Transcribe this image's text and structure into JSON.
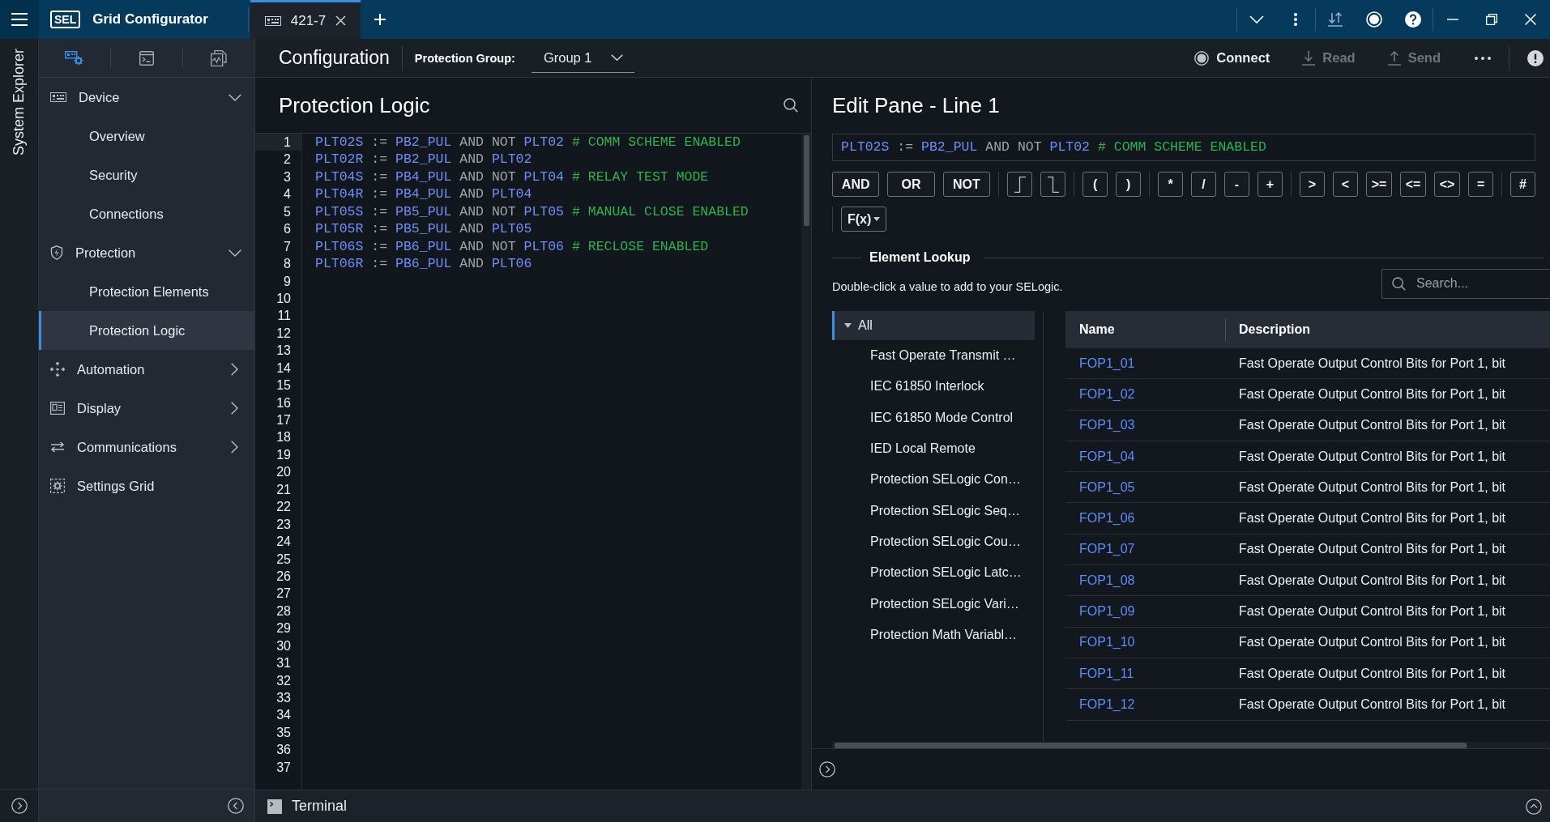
{
  "app": {
    "logo": "SEL",
    "title": "Grid Configurator"
  },
  "tabs": [
    {
      "label": "421-7",
      "selected": true
    }
  ],
  "explorer": {
    "title": "System Explorer"
  },
  "sidebar": {
    "views": [
      {
        "selected": true
      },
      {
        "selected": false
      },
      {
        "selected": false
      }
    ],
    "items": [
      {
        "label": "Device",
        "expanded": true,
        "children": [
          {
            "label": "Overview",
            "selected": false
          },
          {
            "label": "Security",
            "selected": false
          },
          {
            "label": "Connections",
            "selected": false
          }
        ]
      },
      {
        "label": "Protection",
        "expanded": true,
        "children": [
          {
            "label": "Protection Elements",
            "selected": false
          },
          {
            "label": "Protection Logic",
            "selected": true
          }
        ]
      },
      {
        "label": "Automation",
        "expanded": false
      },
      {
        "label": "Display",
        "expanded": false
      },
      {
        "label": "Communications",
        "expanded": false
      },
      {
        "label": "Settings Grid"
      }
    ]
  },
  "header": {
    "title": "Configuration",
    "group_label": "Protection Group:",
    "group_value": "Group 1",
    "actions": [
      {
        "label": "Connect",
        "disabled": false
      },
      {
        "label": "Read",
        "disabled": true
      },
      {
        "label": "Send",
        "disabled": true
      }
    ]
  },
  "logic_pane": {
    "title": "Protection Logic",
    "lines": [
      {
        "number": "1",
        "selected": true,
        "tokens": [
          {
            "kind": "name",
            "text": "PLT02S"
          },
          {
            "kind": "op",
            "text": ":="
          },
          {
            "kind": "name",
            "text": "PB2_PUL"
          },
          {
            "kind": "op",
            "text": "AND"
          },
          {
            "kind": "op",
            "text": "NOT"
          },
          {
            "kind": "name",
            "text": "PLT02"
          },
          {
            "kind": "comment",
            "text": "# COMM SCHEME ENABLED"
          }
        ]
      },
      {
        "number": "2",
        "selected": false,
        "tokens": [
          {
            "kind": "name",
            "text": "PLT02R"
          },
          {
            "kind": "op",
            "text": ":="
          },
          {
            "kind": "name",
            "text": "PB2_PUL"
          },
          {
            "kind": "op",
            "text": "AND"
          },
          {
            "kind": "name",
            "text": "PLT02"
          }
        ]
      },
      {
        "number": "3",
        "selected": false,
        "tokens": [
          {
            "kind": "name",
            "text": "PLT04S"
          },
          {
            "kind": "op",
            "text": ":="
          },
          {
            "kind": "name",
            "text": "PB4_PUL"
          },
          {
            "kind": "op",
            "text": "AND"
          },
          {
            "kind": "op",
            "text": "NOT"
          },
          {
            "kind": "name",
            "text": "PLT04"
          },
          {
            "kind": "comment",
            "text": "# RELAY TEST MODE"
          }
        ]
      },
      {
        "number": "4",
        "selected": false,
        "tokens": [
          {
            "kind": "name",
            "text": "PLT04R"
          },
          {
            "kind": "op",
            "text": ":="
          },
          {
            "kind": "name",
            "text": "PB4_PUL"
          },
          {
            "kind": "op",
            "text": "AND"
          },
          {
            "kind": "name",
            "text": "PLT04"
          }
        ]
      },
      {
        "number": "5",
        "selected": false,
        "tokens": [
          {
            "kind": "name",
            "text": "PLT05S"
          },
          {
            "kind": "op",
            "text": ":="
          },
          {
            "kind": "name",
            "text": "PB5_PUL"
          },
          {
            "kind": "op",
            "text": "AND"
          },
          {
            "kind": "op",
            "text": "NOT"
          },
          {
            "kind": "name",
            "text": "PLT05"
          },
          {
            "kind": "comment",
            "text": "# MANUAL CLOSE ENABLED"
          }
        ]
      },
      {
        "number": "6",
        "selected": false,
        "tokens": [
          {
            "kind": "name",
            "text": "PLT05R"
          },
          {
            "kind": "op",
            "text": ":="
          },
          {
            "kind": "name",
            "text": "PB5_PUL"
          },
          {
            "kind": "op",
            "text": "AND"
          },
          {
            "kind": "name",
            "text": "PLT05"
          }
        ]
      },
      {
        "number": "7",
        "selected": false,
        "tokens": [
          {
            "kind": "name",
            "text": "PLT06S"
          },
          {
            "kind": "op",
            "text": ":="
          },
          {
            "kind": "name",
            "text": "PB6_PUL"
          },
          {
            "kind": "op",
            "text": "AND"
          },
          {
            "kind": "op",
            "text": "NOT"
          },
          {
            "kind": "name",
            "text": "PLT06"
          },
          {
            "kind": "comment",
            "text": "# RECLOSE ENABLED"
          }
        ]
      },
      {
        "number": "8",
        "selected": false,
        "tokens": [
          {
            "kind": "name",
            "text": "PLT06R"
          },
          {
            "kind": "op",
            "text": ":="
          },
          {
            "kind": "name",
            "text": "PB6_PUL"
          },
          {
            "kind": "op",
            "text": "AND"
          },
          {
            "kind": "name",
            "text": "PLT06"
          }
        ]
      },
      {
        "number": "9",
        "selected": false
      },
      {
        "number": "10",
        "selected": false
      },
      {
        "number": "11",
        "selected": false
      },
      {
        "number": "12",
        "selected": false
      },
      {
        "number": "13",
        "selected": false
      },
      {
        "number": "14",
        "selected": false
      },
      {
        "number": "15",
        "selected": false
      },
      {
        "number": "16",
        "selected": false
      },
      {
        "number": "17",
        "selected": false
      },
      {
        "number": "18",
        "selected": false
      },
      {
        "number": "19",
        "selected": false
      },
      {
        "number": "20",
        "selected": false
      },
      {
        "number": "21",
        "selected": false
      },
      {
        "number": "22",
        "selected": false
      },
      {
        "number": "23",
        "selected": false
      },
      {
        "number": "24",
        "selected": false
      },
      {
        "number": "25",
        "selected": false
      },
      {
        "number": "26",
        "selected": false
      },
      {
        "number": "27",
        "selected": false
      },
      {
        "number": "28",
        "selected": false
      },
      {
        "number": "29",
        "selected": false
      },
      {
        "number": "30",
        "selected": false
      },
      {
        "number": "31",
        "selected": false
      },
      {
        "number": "32",
        "selected": false
      },
      {
        "number": "33",
        "selected": false
      },
      {
        "number": "34",
        "selected": false
      },
      {
        "number": "35",
        "selected": false
      },
      {
        "number": "36",
        "selected": false
      },
      {
        "number": "37",
        "selected": false
      }
    ]
  },
  "edit_pane": {
    "title": "Edit Pane - Line 1",
    "expression": {
      "tokens": [
        {
          "kind": "name",
          "text": "PLT02S"
        },
        {
          "kind": "op",
          "text": ":="
        },
        {
          "kind": "name",
          "text": "PB2_PUL"
        },
        {
          "kind": "op",
          "text": "AND"
        },
        {
          "kind": "op",
          "text": "NOT"
        },
        {
          "kind": "name",
          "text": "PLT02"
        },
        {
          "kind": "comment",
          "text": "# COMM SCHEME ENABLED"
        }
      ]
    },
    "operator_groups": [
      [
        {
          "kind": "logic",
          "label": "AND"
        },
        {
          "kind": "logic",
          "label": "OR"
        },
        {
          "kind": "logic",
          "label": "NOT"
        }
      ],
      [
        {
          "kind": "rising-edge"
        },
        {
          "kind": "falling-edge"
        }
      ],
      [
        {
          "kind": "symbol",
          "label": "("
        },
        {
          "kind": "symbol",
          "label": ")"
        }
      ],
      [
        {
          "kind": "symbol",
          "label": "*"
        },
        {
          "kind": "symbol",
          "label": "/"
        },
        {
          "kind": "symbol",
          "label": "-"
        },
        {
          "kind": "symbol",
          "label": "+"
        }
      ],
      [
        {
          "kind": "symbol",
          "label": ">"
        },
        {
          "kind": "symbol",
          "label": "<"
        },
        {
          "kind": "symbol",
          "label": ">="
        },
        {
          "kind": "symbol",
          "label": "<="
        },
        {
          "kind": "symbol",
          "label": "<>"
        },
        {
          "kind": "symbol",
          "label": "="
        }
      ],
      [
        {
          "kind": "symbol",
          "label": "#"
        }
      ]
    ],
    "function_menu": "F(x)",
    "lookup": {
      "title": "Element Lookup",
      "hint": "Double-click a value to add to your SELogic.",
      "search": {
        "placeholder": "Search..."
      },
      "tree": {
        "label": "All",
        "expanded": true,
        "selected": true,
        "children": [
          {
            "label": "Fast Operate Transmit …",
            "selected": false
          },
          {
            "label": "IEC 61850 Interlock",
            "selected": false
          },
          {
            "label": "IEC 61850 Mode Control",
            "selected": false
          },
          {
            "label": "IED Local Remote",
            "selected": false
          },
          {
            "label": "Protection SELogic Con…",
            "selected": false
          },
          {
            "label": "Protection SELogic Seq…",
            "selected": false
          },
          {
            "label": "Protection SELogic Cou…",
            "selected": false
          },
          {
            "label": "Protection SELogic Latc…",
            "selected": false
          },
          {
            "label": "Protection SELogic Vari…",
            "selected": false
          },
          {
            "label": "Protection Math Variabl…",
            "selected": false
          }
        ]
      },
      "table": {
        "columns": [
          "Name",
          "Description"
        ],
        "rows": [
          {
            "name": "FOP1_01",
            "description": "Fast Operate Output Control Bits for Port 1, bit"
          },
          {
            "name": "FOP1_02",
            "description": "Fast Operate Output Control Bits for Port 1, bit"
          },
          {
            "name": "FOP1_03",
            "description": "Fast Operate Output Control Bits for Port 1, bit"
          },
          {
            "name": "FOP1_04",
            "description": "Fast Operate Output Control Bits for Port 1, bit"
          },
          {
            "name": "FOP1_05",
            "description": "Fast Operate Output Control Bits for Port 1, bit"
          },
          {
            "name": "FOP1_06",
            "description": "Fast Operate Output Control Bits for Port 1, bit"
          },
          {
            "name": "FOP1_07",
            "description": "Fast Operate Output Control Bits for Port 1, bit"
          },
          {
            "name": "FOP1_08",
            "description": "Fast Operate Output Control Bits for Port 1, bit"
          },
          {
            "name": "FOP1_09",
            "description": "Fast Operate Output Control Bits for Port 1, bit"
          },
          {
            "name": "FOP1_10",
            "description": "Fast Operate Output Control Bits for Port 1, bit"
          },
          {
            "name": "FOP1_11",
            "description": "Fast Operate Output Control Bits for Port 1, bit"
          },
          {
            "name": "FOP1_12",
            "description": "Fast Operate Output Control Bits for Port 1, bit"
          }
        ]
      }
    }
  },
  "terminal": {
    "label": "Terminal"
  }
}
